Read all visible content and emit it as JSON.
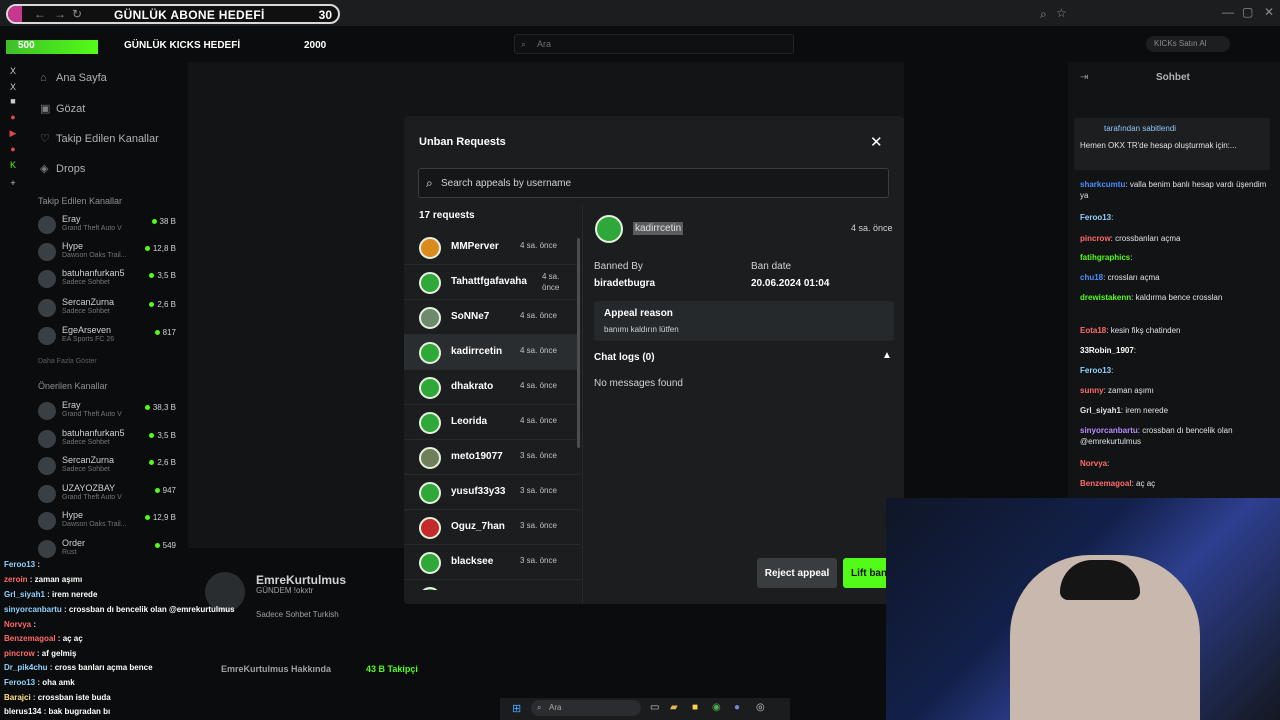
{
  "browser": {
    "subscriber_goal": {
      "label": "GÜNLÜK ABONE HEDEFİ",
      "value": "30"
    },
    "kicks_goal": {
      "current": "500",
      "label": "GÜNLÜK KICKS HEDEFİ",
      "target": "2000"
    },
    "search_placeholder": "Ara",
    "buy_kicks": "KICKs Satın Al"
  },
  "sidebar": {
    "nav": [
      {
        "label": "Ana Sayfa",
        "icon": "home-icon"
      },
      {
        "label": "Gözat",
        "icon": "browse-icon"
      },
      {
        "label": "Takip Edilen Kanallar",
        "icon": "heart-icon"
      },
      {
        "label": "Drops",
        "icon": "drops-icon"
      }
    ],
    "followed_title": "Takip Edilen Kanallar",
    "followed": [
      {
        "name": "Eray",
        "category": "Grand Theft Auto V",
        "viewers": "38 B"
      },
      {
        "name": "Hype",
        "category": "Dawson Oaks Trail...",
        "viewers": "12,8 B"
      },
      {
        "name": "batuhanfurkan5",
        "category": "Sadece Sohbet",
        "viewers": "3,5 B"
      },
      {
        "name": "SercanZurna",
        "category": "Sadece Sohbet",
        "viewers": "2,6 B"
      },
      {
        "name": "EgeArseven",
        "category": "EA Sports FC 26",
        "viewers": "817"
      }
    ],
    "show_more": "Daha Fazla Göster",
    "recommended_title": "Önerilen Kanallar",
    "recommended": [
      {
        "name": "Eray",
        "category": "Grand Theft Auto V",
        "viewers": "38,3 B"
      },
      {
        "name": "batuhanfurkan5",
        "category": "Sadece Sohbet",
        "viewers": "3,5 B"
      },
      {
        "name": "SercanZurna",
        "category": "Sadece Sohbet",
        "viewers": "2,6 B"
      },
      {
        "name": "UZAYOZBAY",
        "category": "Grand Theft Auto V",
        "viewers": "947"
      },
      {
        "name": "Hype",
        "category": "Dawson Oaks Trail...",
        "viewers": "12,9 B"
      },
      {
        "name": "Order",
        "category": "Rust",
        "viewers": "549"
      }
    ]
  },
  "modal": {
    "title": "Unban Requests",
    "search_placeholder": "Search appeals by username",
    "count": "17 requests",
    "requests": [
      {
        "name": "MMPerver",
        "time": "4 sa. önce"
      },
      {
        "name": "Tahattfgafavaha",
        "time": "4 sa. önce"
      },
      {
        "name": "SoNNe7",
        "time": "4 sa. önce"
      },
      {
        "name": "kadirrcetin",
        "time": "4 sa. önce"
      },
      {
        "name": "dhakrato",
        "time": "4 sa. önce"
      },
      {
        "name": "Leorida",
        "time": "4 sa. önce"
      },
      {
        "name": "meto19077",
        "time": "3 sa. önce"
      },
      {
        "name": "yusuf33y33",
        "time": "3 sa. önce"
      },
      {
        "name": "Oguz_7han",
        "time": "3 sa. önce"
      },
      {
        "name": "blacksee",
        "time": "3 sa. önce"
      }
    ],
    "selected": {
      "username": "kadirrcetin",
      "time": "4 sa. önce",
      "banned_by_label": "Banned By",
      "banned_by": "biradetbugra",
      "ban_date_label": "Ban date",
      "ban_date": "20.06.2024 01:04",
      "appeal_reason_label": "Appeal reason",
      "appeal_reason": "banımı kaldırın lütfen",
      "chat_logs_label": "Chat logs (0)",
      "no_messages": "No messages found"
    },
    "reject_label": "Reject appeal",
    "lift_label": "Lift ban"
  },
  "chat": {
    "title": "Sohbet",
    "pinned_by": "tarafından sabitlendi",
    "pinned_message": "Hemen OKX TR'de hesap oluşturmak için:...",
    "messages": [
      {
        "user": "sharkcumtu",
        "text": "valla benim banlı hesap vardı üşendim ya",
        "color": "#4e8cff"
      },
      {
        "user": "Feroo13",
        "text": "",
        "color": "#8fd3ff"
      },
      {
        "user": "pincrow",
        "text": "crossbanları açma",
        "color": "#ff6b6b"
      },
      {
        "user": "fatihgraphics",
        "text": "",
        "color": "#53fc18"
      },
      {
        "user": "chu18",
        "text": "crossları açma",
        "color": "#4e8cff"
      },
      {
        "user": "drewistakenn",
        "text": "kaldırma bence crosslan",
        "color": "#53fc18"
      },
      {
        "user": "Eota18",
        "text": "kesin fikş chatinden",
        "color": "#ff6b6b"
      },
      {
        "user": "33Robin_1907",
        "text": "",
        "color": "#ffffff"
      },
      {
        "user": "Feroo13",
        "text": "",
        "color": "#8fd3ff"
      },
      {
        "user": "sunny",
        "text": "zaman aşımı",
        "color": "#ff6b6b"
      },
      {
        "user": "Grl_siyah1",
        "text": "irem nerede",
        "color": "#dfe3e6"
      },
      {
        "user": "sinyorcanbartu",
        "text": "crossban dı bencelik olan @emrekurtulmus",
        "color": "#b98cff"
      },
      {
        "user": "Norvya",
        "text": "",
        "color": "#ff6b6b"
      },
      {
        "user": "Benzemagoal",
        "text": "aç aç",
        "color": "#ff6b6b"
      }
    ]
  },
  "overlay_chat": [
    {
      "user": "Feroo13",
      "text": "",
      "color": "#8fd3ff"
    },
    {
      "user": "zeroin",
      "text": "zaman aşımı",
      "color": "#ff6b6b"
    },
    {
      "user": "Grl_siyah1",
      "text": "irem nerede",
      "color": "#8fd3ff"
    },
    {
      "user": "sinyorcanbartu",
      "text": "crossban dı bencelik olan @emrekurtulmus",
      "color": "#8fd3ff"
    },
    {
      "user": "Norvya",
      "text": "",
      "color": "#ff6b6b"
    },
    {
      "user": "Benzemagoal",
      "text": "aç aç",
      "color": "#ff6b6b"
    },
    {
      "user": "pincrow",
      "text": "af gelmiş",
      "color": "#ff6b6b"
    },
    {
      "user": "Dr_pik4chu",
      "text": "cross banları açma bence",
      "color": "#8fd3ff"
    },
    {
      "user": "Feroo13",
      "text": "oha amk",
      "color": "#8fd3ff"
    },
    {
      "user": "Barajci",
      "text": "crossban iste buda",
      "color": "#ffe08a"
    },
    {
      "user": "blerus134",
      "text": "bak bugradan bı",
      "color": "#ffffff"
    }
  ],
  "stream": {
    "name": "EmreKurtulmus",
    "category": "GÜNDEM !okxtr",
    "tags": "Sadece Sohbet  Turkish",
    "about": "EmreKurtulmus Hakkında",
    "followers": "43 B Takipçi"
  },
  "taskbar": {
    "search": "Ara"
  }
}
